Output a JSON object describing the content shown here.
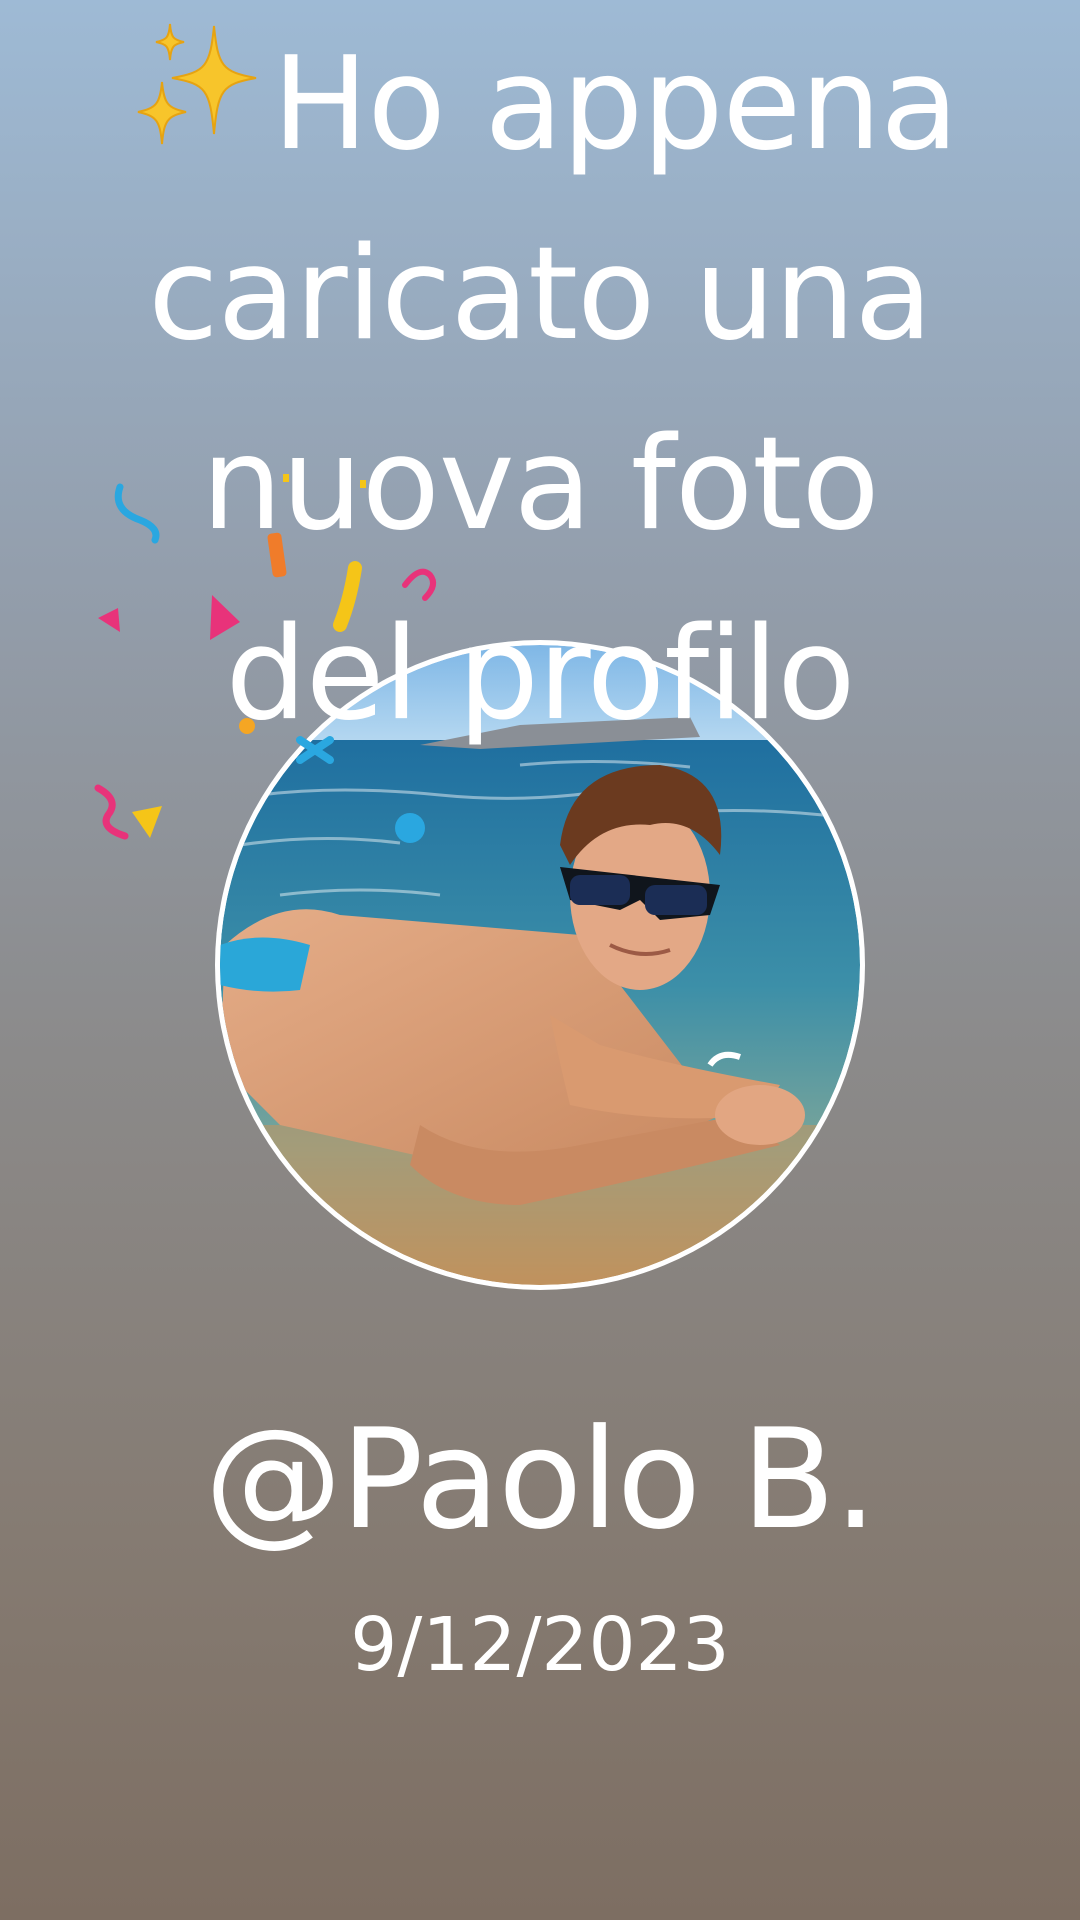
{
  "story": {
    "headline_lines": [
      "Ho appena",
      "caricato una",
      "nuova foto",
      "del profilo"
    ],
    "headline_emoji": "sparkles-icon",
    "username": "@Paolo B.",
    "date": "9/12/2023",
    "avatar_icon": "profile-photo-beach"
  },
  "colors": {
    "background_top": "#9ebad5",
    "background_bottom": "#7d6e62",
    "text": "#ffffff",
    "confetti": [
      "#2aa7e0",
      "#f07c2a",
      "#f5c518",
      "#e8337a"
    ]
  }
}
